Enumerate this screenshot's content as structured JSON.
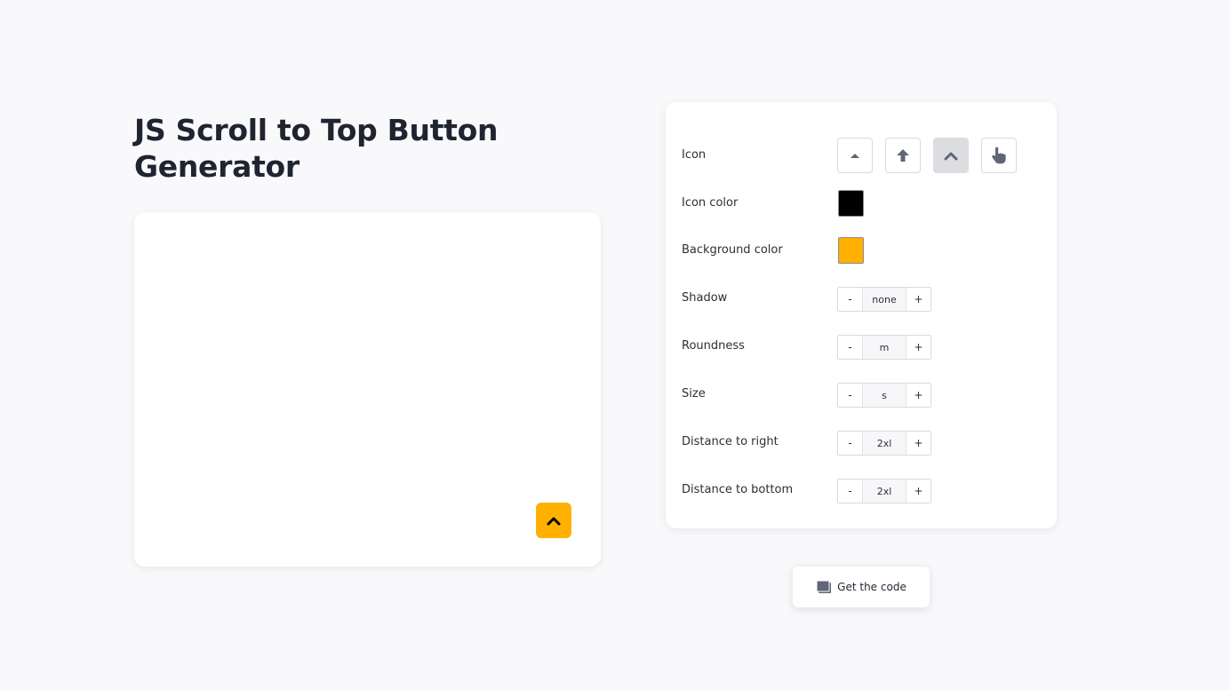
{
  "page": {
    "title": "JS Scroll to Top Button Generator"
  },
  "preview": {
    "icon": "chevron-up-icon",
    "icon_color": "#000000",
    "background_color": "#FFB000"
  },
  "settings": {
    "icon": {
      "label": "Icon",
      "options": [
        "caret-up-icon",
        "arrow-up-icon",
        "chevron-up-icon",
        "pointing-hand-icon"
      ],
      "selected": "chevron-up-icon"
    },
    "icon_color": {
      "label": "Icon color",
      "value": "#000000"
    },
    "background_color": {
      "label": "Background color",
      "value": "#FFB000"
    },
    "shadow": {
      "label": "Shadow",
      "value": "none",
      "minus": "-",
      "plus": "+"
    },
    "roundness": {
      "label": "Roundness",
      "value": "m",
      "minus": "-",
      "plus": "+"
    },
    "size": {
      "label": "Size",
      "value": "s",
      "minus": "-",
      "plus": "+"
    },
    "distance_right": {
      "label": "Distance to right",
      "value": "2xl",
      "minus": "-",
      "plus": "+"
    },
    "distance_bottom": {
      "label": "Distance to bottom",
      "value": "2xl",
      "minus": "-",
      "plus": "+"
    }
  },
  "get_code": {
    "label": "Get the code",
    "icon": "copy-icon"
  },
  "colors": {
    "icon_gray": "#5f6675",
    "page_background": "#F9F9FB"
  }
}
